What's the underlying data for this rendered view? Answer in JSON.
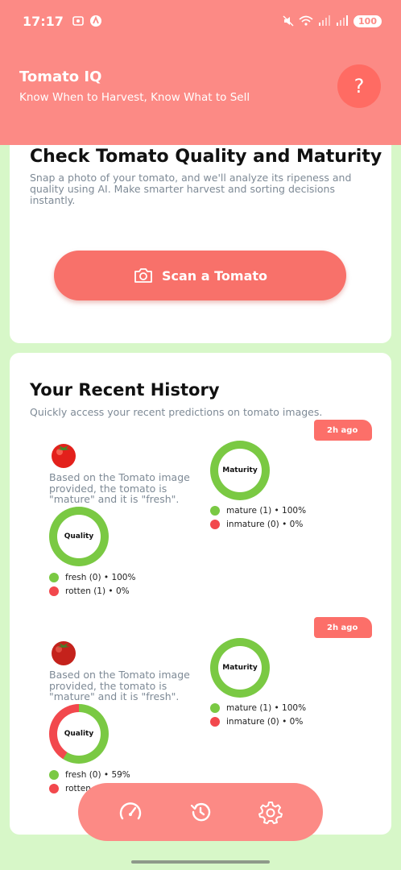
{
  "status_bar": {
    "time": "17:17",
    "battery": "100"
  },
  "header": {
    "title": "Tomato IQ",
    "subtitle": "Know When to Harvest, Know What to Sell",
    "help_label": "?"
  },
  "scan_card": {
    "title": "Check Tomato Quality and Maturity",
    "description": "Snap a photo of your tomato, and we'll analyze its ripeness and quality using AI. Make smarter harvest and sorting decisions instantly.",
    "button_label": "Scan a Tomato"
  },
  "history": {
    "title": "Your Recent History",
    "description": "Quickly access your recent predictions on tomato images.",
    "entries": [
      {
        "time": "2h ago",
        "summary": "Based on the Tomato image provided, the tomato is \"mature\" and it is \"fresh\".",
        "maturity": {
          "label": "Maturity",
          "fraction_primary": 1.0,
          "legend": [
            {
              "text": "mature (1) • 100%",
              "color": "#7ac943"
            },
            {
              "text": "inmature (0) • 0%",
              "color": "#f2484d"
            }
          ]
        },
        "quality": {
          "label": "Quality",
          "fraction_primary": 1.0,
          "legend": [
            {
              "text": "fresh (0) • 100%",
              "color": "#7ac943"
            },
            {
              "text": "rotten (1) • 0%",
              "color": "#f2484d"
            }
          ]
        }
      },
      {
        "time": "2h ago",
        "summary": "Based on the Tomato image provided, the tomato is \"mature\" and it is \"fresh\".",
        "maturity": {
          "label": "Maturity",
          "fraction_primary": 1.0,
          "legend": [
            {
              "text": "mature (1) • 100%",
              "color": "#7ac943"
            },
            {
              "text": "inmature (0) • 0%",
              "color": "#f2484d"
            }
          ]
        },
        "quality": {
          "label": "Quality",
          "fraction_primary": 0.59,
          "legend": [
            {
              "text": "fresh (0) • 59%",
              "color": "#7ac943"
            },
            {
              "text": "rotten",
              "color": "#f2484d"
            }
          ]
        }
      }
    ]
  },
  "nav": {
    "items": [
      "dashboard-icon",
      "history-icon",
      "settings-icon"
    ]
  },
  "colors": {
    "header": "#fc8a85",
    "accent": "#f8716a",
    "positive": "#7ac943",
    "negative": "#f2484d",
    "background": "#d7f7c8"
  }
}
